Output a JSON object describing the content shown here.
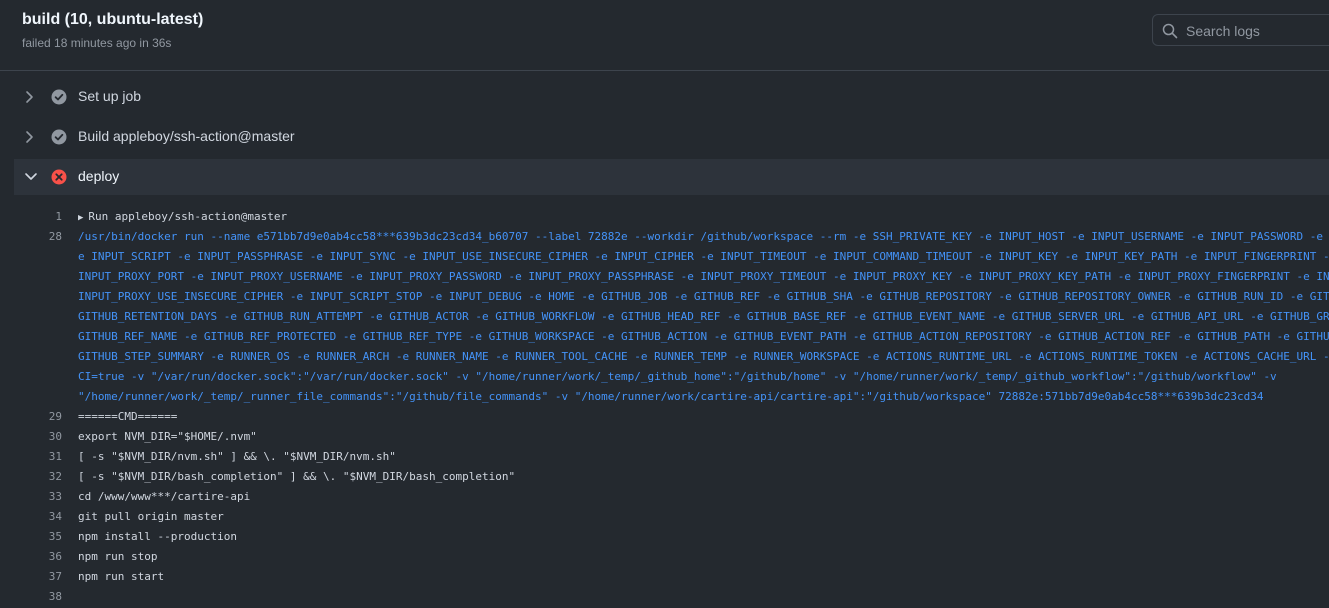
{
  "header": {
    "title": "build (10, ubuntu-latest)",
    "subtitle": "failed 18 minutes ago in 36s",
    "search_placeholder": "Search logs"
  },
  "steps": [
    {
      "label": "Set up job",
      "status": "success",
      "expanded": false
    },
    {
      "label": "Build appleboy/ssh-action@master",
      "status": "success",
      "expanded": false
    },
    {
      "label": "deploy",
      "status": "failure",
      "expanded": true
    }
  ],
  "colors": {
    "success_icon": "#9198a1",
    "failure_icon": "#f85149",
    "command_text": "#4493f8"
  },
  "log": {
    "group_line": {
      "num": "1",
      "text": "Run appleboy/ssh-action@master"
    },
    "cmd_num": "28",
    "cmd_lines": [
      "/usr/bin/docker run --name e571bb7d9e0ab4cc58***639b3dc23cd34_b60707 --label 72882e --workdir /github/workspace --rm -e SSH_PRIVATE_KEY -e INPUT_HOST -e INPUT_USERNAME -e INPUT_PASSWORD -e I",
      "e INPUT_SCRIPT -e INPUT_PASSPHRASE -e INPUT_SYNC -e INPUT_USE_INSECURE_CIPHER -e INPUT_CIPHER -e INPUT_TIMEOUT -e INPUT_COMMAND_TIMEOUT -e INPUT_KEY -e INPUT_KEY_PATH -e INPUT_FINGERPRINT -e",
      "INPUT_PROXY_PORT -e INPUT_PROXY_USERNAME -e INPUT_PROXY_PASSWORD -e INPUT_PROXY_PASSPHRASE -e INPUT_PROXY_TIMEOUT -e INPUT_PROXY_KEY -e INPUT_PROXY_KEY_PATH -e INPUT_PROXY_FINGERPRINT -e INP",
      "INPUT_PROXY_USE_INSECURE_CIPHER -e INPUT_SCRIPT_STOP -e INPUT_DEBUG -e HOME -e GITHUB_JOB -e GITHUB_REF -e GITHUB_SHA -e GITHUB_REPOSITORY -e GITHUB_REPOSITORY_OWNER -e GITHUB_RUN_ID -e GITH",
      "GITHUB_RETENTION_DAYS -e GITHUB_RUN_ATTEMPT -e GITHUB_ACTOR -e GITHUB_WORKFLOW -e GITHUB_HEAD_REF -e GITHUB_BASE_REF -e GITHUB_EVENT_NAME -e GITHUB_SERVER_URL -e GITHUB_API_URL -e GITHUB_GRA",
      "GITHUB_REF_NAME -e GITHUB_REF_PROTECTED -e GITHUB_REF_TYPE -e GITHUB_WORKSPACE -e GITHUB_ACTION -e GITHUB_EVENT_PATH -e GITHUB_ACTION_REPOSITORY -e GITHUB_ACTION_REF -e GITHUB_PATH -e GITHUE",
      "GITHUB_STEP_SUMMARY -e RUNNER_OS -e RUNNER_ARCH -e RUNNER_NAME -e RUNNER_TOOL_CACHE -e RUNNER_TEMP -e RUNNER_WORKSPACE -e ACTIONS_RUNTIME_URL -e ACTIONS_RUNTIME_TOKEN -e ACTIONS_CACHE_URL -e",
      "CI=true -v \"/var/run/docker.sock\":\"/var/run/docker.sock\" -v \"/home/runner/work/_temp/_github_home\":\"/github/home\" -v \"/home/runner/work/_temp/_github_workflow\":\"/github/workflow\" -v",
      "\"/home/runner/work/_temp/_runner_file_commands\":\"/github/file_commands\" -v \"/home/runner/work/cartire-api/cartire-api\":\"/github/workspace\" 72882e:571bb7d9e0ab4cc58***639b3dc23cd34"
    ],
    "lines": [
      {
        "num": "29",
        "text": "======CMD======"
      },
      {
        "num": "30",
        "text": "export NVM_DIR=\"$HOME/.nvm\""
      },
      {
        "num": "31",
        "text": "[ -s \"$NVM_DIR/nvm.sh\" ] && \\. \"$NVM_DIR/nvm.sh\""
      },
      {
        "num": "32",
        "text": "[ -s \"$NVM_DIR/bash_completion\" ] && \\. \"$NVM_DIR/bash_completion\""
      },
      {
        "num": "33",
        "text": "cd /www/www***/cartire-api"
      },
      {
        "num": "34",
        "text": "git pull origin master"
      },
      {
        "num": "35",
        "text": "npm install --production"
      },
      {
        "num": "36",
        "text": "npm run stop"
      },
      {
        "num": "37",
        "text": "npm run start"
      },
      {
        "num": "38",
        "text": ""
      }
    ]
  }
}
